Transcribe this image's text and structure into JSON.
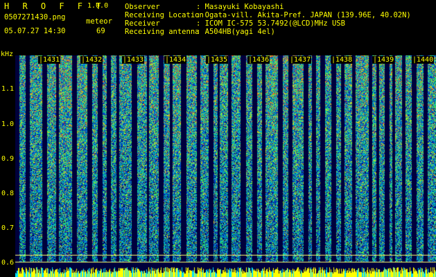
{
  "app": {
    "title": "H R O F F T",
    "version": "1.0.0"
  },
  "file": {
    "name": "0507271430.png",
    "datetime": "05.07.27 14:30"
  },
  "meteor": {
    "label": "meteor",
    "count": "69"
  },
  "station": {
    "labels": [
      "Observer",
      "Receiving Location",
      "Receiver",
      "Receiving antenna"
    ],
    "values": [
      ": Masayuki Kobayashi",
      ": Ogata-vill. Akita-Pref. JAPAN (139.96E, 40.02N)",
      ": ICOM IC-575 53.7492(@LCD)MHz USB",
      ": A504HB(yagi 4el)"
    ]
  },
  "y_axis": {
    "unit": "kHz",
    "ticks": [
      "1.1",
      "1.0",
      "0.9",
      "0.8",
      "0.7",
      "0.6"
    ]
  },
  "x_axis": {
    "ticks": [
      "1431",
      "1432",
      "1433",
      "1434",
      "1435",
      "1436",
      "1437",
      "1438",
      "1439",
      "1440"
    ]
  },
  "colors": {
    "text": "#ffff00",
    "background": "#000000",
    "baseline": "#ffff66"
  }
}
